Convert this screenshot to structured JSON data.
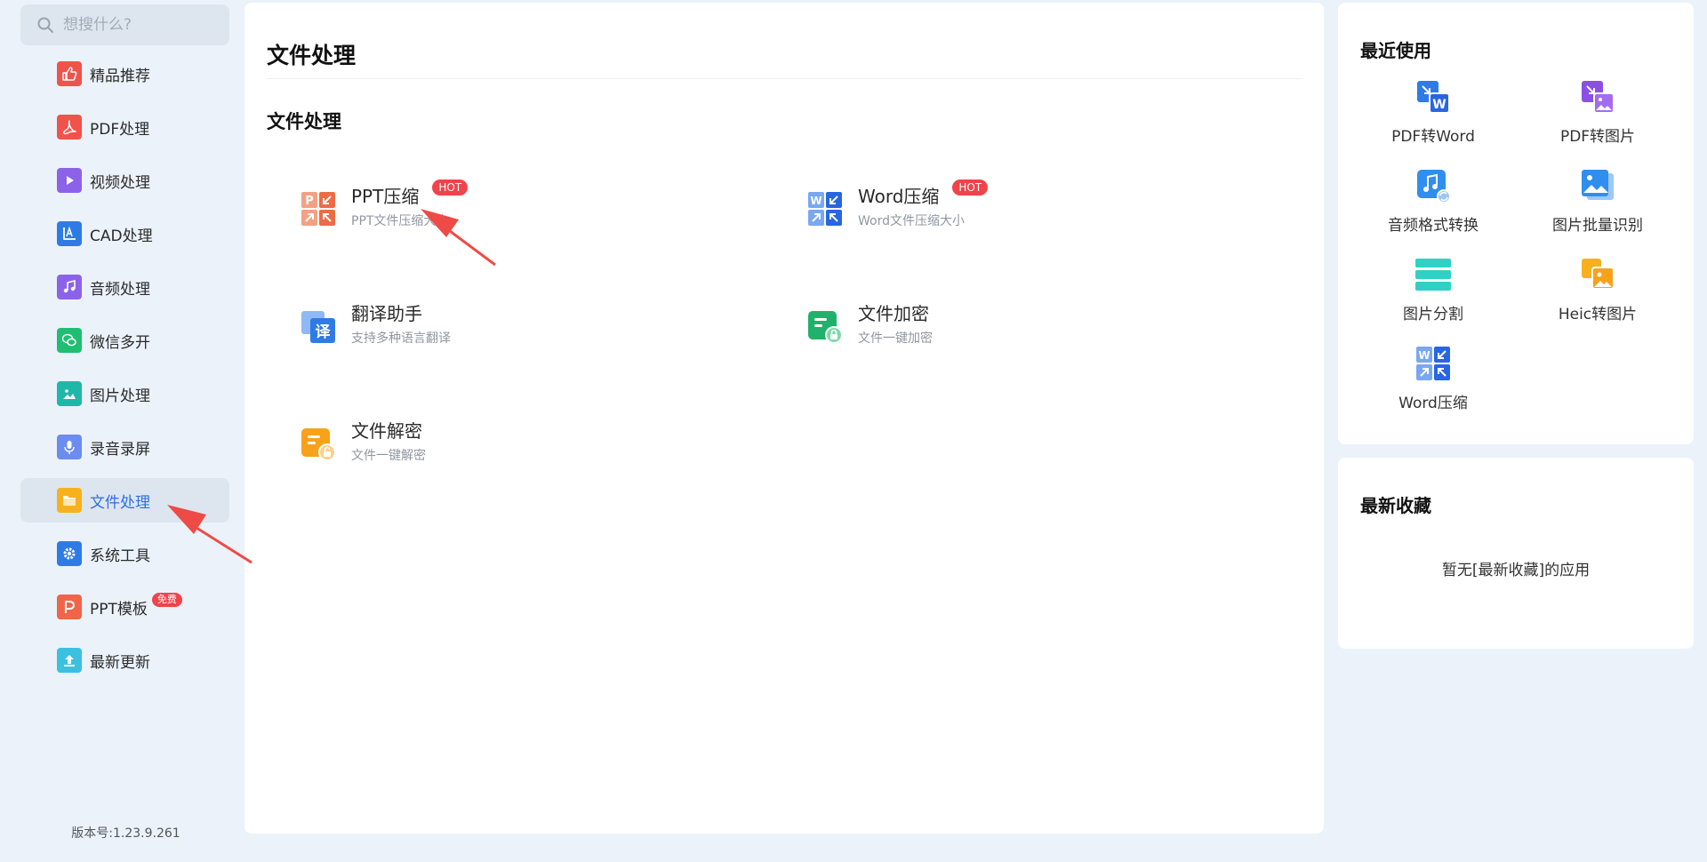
{
  "search": {
    "placeholder": "想搜什么?"
  },
  "sidebar": {
    "items": [
      {
        "label": "精品推荐",
        "icon": "thumbs-up-icon",
        "color": "#f1534a"
      },
      {
        "label": "PDF处理",
        "icon": "pdf-icon",
        "color": "#f1534a"
      },
      {
        "label": "视频处理",
        "icon": "play-icon",
        "color": "#8c63e8"
      },
      {
        "label": "CAD处理",
        "icon": "cad-icon",
        "color": "#2f7be6"
      },
      {
        "label": "音频处理",
        "icon": "music-icon",
        "color": "#8c63e8"
      },
      {
        "label": "微信多开",
        "icon": "wechat-icon",
        "color": "#1fbf72"
      },
      {
        "label": "图片处理",
        "icon": "image-icon",
        "color": "#1fb8a8"
      },
      {
        "label": "录音录屏",
        "icon": "microphone-icon",
        "color": "#6c8cf0"
      },
      {
        "label": "文件处理",
        "icon": "folder-icon",
        "color": "#f7b11d"
      },
      {
        "label": "系统工具",
        "icon": "gear-icon",
        "color": "#2f7be6"
      },
      {
        "label": "PPT模板",
        "icon": "ppt-icon",
        "color": "#f0654a",
        "badge": "免费"
      },
      {
        "label": "最新更新",
        "icon": "upload-icon",
        "color": "#3cc0e0"
      }
    ],
    "active_index": 8,
    "version": "版本号:1.23.9.261"
  },
  "main": {
    "page_title": "文件处理",
    "section_title": "文件处理",
    "tools": [
      {
        "name": "PPT压缩",
        "desc": "PPT文件压缩大小",
        "badge": "HOT",
        "icon": "ppt-compress-icon"
      },
      {
        "name": "Word压缩",
        "desc": "Word文件压缩大小",
        "badge": "HOT",
        "icon": "word-compress-icon"
      },
      {
        "name": "翻译助手",
        "desc": "支持多种语言翻译",
        "icon": "translate-icon"
      },
      {
        "name": "文件加密",
        "desc": "文件一键加密",
        "icon": "file-encrypt-icon"
      },
      {
        "name": "文件解密",
        "desc": "文件一键解密",
        "icon": "file-decrypt-icon"
      }
    ]
  },
  "recent": {
    "title": "最近使用",
    "items": [
      {
        "label": "PDF转Word",
        "icon": "pdf-to-word-icon"
      },
      {
        "label": "PDF转图片",
        "icon": "pdf-to-image-icon"
      },
      {
        "label": "音频格式转换",
        "icon": "audio-convert-icon"
      },
      {
        "label": "图片批量识别",
        "icon": "image-recognize-icon"
      },
      {
        "label": "图片分割",
        "icon": "image-split-icon"
      },
      {
        "label": "Heic转图片",
        "icon": "heic-to-image-icon"
      },
      {
        "label": "Word压缩",
        "icon": "word-compress-icon"
      }
    ]
  },
  "favorites": {
    "title": "最新收藏",
    "empty_text": "暂无[最新收藏]的应用"
  }
}
